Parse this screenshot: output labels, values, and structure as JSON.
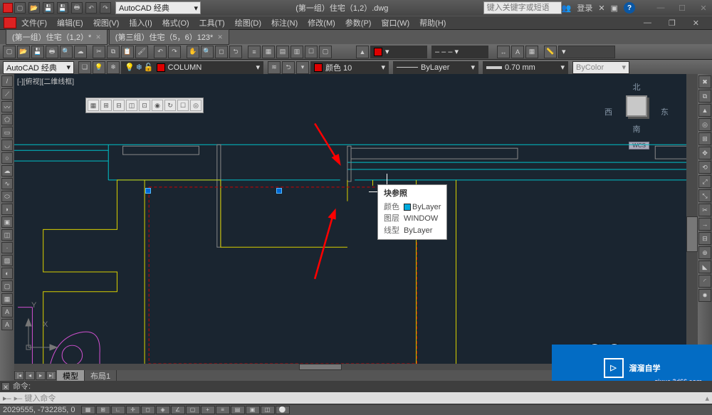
{
  "title_bar": {
    "workspace": "AutoCAD 经典",
    "doc_title": "(第一组）住宅（1,2）.dwg",
    "search_ph": "键入关键字或短语",
    "login": "登录"
  },
  "menus": {
    "file": "文件(F)",
    "edit": "编辑(E)",
    "view": "视图(V)",
    "insert": "插入(I)",
    "format": "格式(O)",
    "tools": "工具(T)",
    "draw": "绘图(D)",
    "dimension": "标注(N)",
    "modify": "修改(M)",
    "param": "参数(P)",
    "window": "窗口(W)",
    "help": "帮助(H)"
  },
  "file_tabs": {
    "tab1": "(第一组）住宅（1,2）*",
    "tab2": "(第三组）住宅（5，6）123*"
  },
  "layer_bar": {
    "workspace_dd": "AutoCAD 经典",
    "layer_name": "COLUMN",
    "color_label": "颜色 10",
    "linetype": "ByLayer",
    "lineweight": "0.70 mm",
    "plotstyle": "ByColor"
  },
  "viewport": {
    "label": "[-][俯视][二维线框]"
  },
  "viewcube": {
    "n": "北",
    "s": "南",
    "e": "东",
    "w": "西",
    "wcs": "WCS"
  },
  "tooltip": {
    "title": "块参照",
    "k_color": "颜色",
    "v_color": "ByLayer",
    "k_layer": "图层",
    "v_layer": "WINDOW",
    "k_ltype": "线型",
    "v_ltype": "ByLayer"
  },
  "model_tabs": {
    "model": "模型",
    "layout1": "布局1"
  },
  "command": {
    "label": "命令:",
    "input": "",
    "prompt": "▸– 键入命令"
  },
  "status": {
    "coords": "2029555, -732285, 0"
  },
  "watermark": {
    "brand": "溜溜自学",
    "url": "zixue.3d66.com"
  },
  "ucs": {
    "x": "X",
    "y": "Y"
  }
}
